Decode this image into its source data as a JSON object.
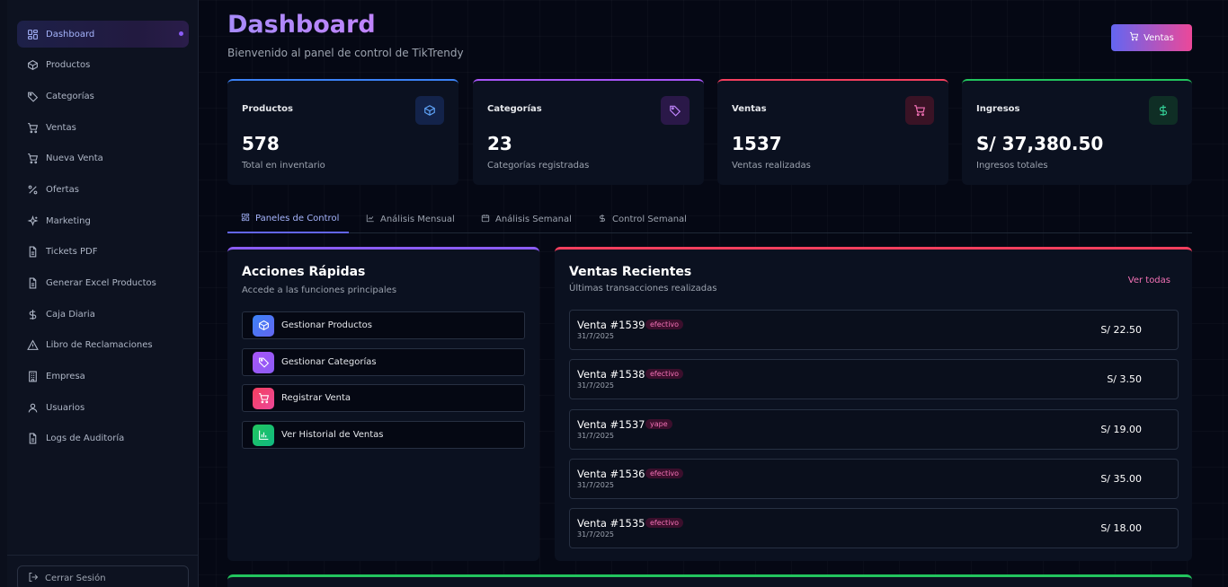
{
  "sidebar": {
    "items": [
      {
        "label": "Dashboard",
        "icon": "grid-icon"
      },
      {
        "label": "Productos",
        "icon": "box-icon"
      },
      {
        "label": "Categorías",
        "icon": "tag-icon"
      },
      {
        "label": "Ventas",
        "icon": "cart-icon"
      },
      {
        "label": "Nueva Venta",
        "icon": "cart-icon"
      },
      {
        "label": "Ofertas",
        "icon": "percent-icon"
      },
      {
        "label": "Marketing",
        "icon": "sparkles-icon"
      },
      {
        "label": "Tickets PDF",
        "icon": "file-icon"
      },
      {
        "label": "Generar Excel Productos",
        "icon": "file-icon"
      },
      {
        "label": "Caja Diaria",
        "icon": "dollar-icon"
      },
      {
        "label": "Libro de Reclamaciones",
        "icon": "alert-triangle-icon"
      },
      {
        "label": "Empresa",
        "icon": "building-icon"
      },
      {
        "label": "Usuarios",
        "icon": "user-icon"
      },
      {
        "label": "Logs de Auditoría",
        "icon": "file-icon"
      }
    ],
    "logout_label": "Cerrar Sesión"
  },
  "header": {
    "title": "Dashboard",
    "subtitle": "Bienvenido al panel de control de TikTrendy",
    "button_label": "Ventas"
  },
  "stats": [
    {
      "label": "Productos",
      "value": "578",
      "desc": "Total en inventario",
      "icon": "box-icon",
      "color": "#3b82f6"
    },
    {
      "label": "Categorías",
      "value": "23",
      "desc": "Categorías registradas",
      "icon": "tag-icon",
      "color": "#a855f7"
    },
    {
      "label": "Ventas",
      "value": "1537",
      "desc": "Ventas realizadas",
      "icon": "cart-icon",
      "color": "#f43f5e"
    },
    {
      "label": "Ingresos",
      "value": "S/ 37,380.50",
      "desc": "Ingresos totales",
      "icon": "dollar-icon",
      "color": "#22c55e"
    }
  ],
  "tabs": [
    {
      "label": "Paneles de Control",
      "icon": "grid-icon",
      "active": true
    },
    {
      "label": "Análisis Mensual",
      "icon": "chart-line-icon",
      "active": false
    },
    {
      "label": "Análisis Semanal",
      "icon": "calendar-icon",
      "active": false
    },
    {
      "label": "Control Semanal",
      "icon": "dollar-icon",
      "active": false
    }
  ],
  "quick_actions": {
    "title": "Acciones Rápidas",
    "subtitle": "Accede a las funciones principales",
    "items": [
      {
        "label": "Gestionar Productos",
        "icon": "box-icon"
      },
      {
        "label": "Gestionar Categorías",
        "icon": "tag-icon"
      },
      {
        "label": "Registrar Venta",
        "icon": "cart-icon"
      },
      {
        "label": "Ver Historial de Ventas",
        "icon": "bar-chart-icon"
      }
    ]
  },
  "recent_sales": {
    "title": "Ventas Recientes",
    "subtitle": "Últimas transacciones realizadas",
    "link_label": "Ver todas",
    "items": [
      {
        "id": "Venta #1539",
        "method": "efectivo",
        "date": "31/7/2025",
        "amount": "S/ 22.50"
      },
      {
        "id": "Venta #1538",
        "method": "efectivo",
        "date": "31/7/2025",
        "amount": "S/ 3.50"
      },
      {
        "id": "Venta #1537",
        "method": "yape",
        "date": "31/7/2025",
        "amount": "S/ 19.00"
      },
      {
        "id": "Venta #1536",
        "method": "efectivo",
        "date": "31/7/2025",
        "amount": "S/ 35.00"
      },
      {
        "id": "Venta #1535",
        "method": "efectivo",
        "date": "31/7/2025",
        "amount": "S/ 18.00"
      }
    ]
  }
}
